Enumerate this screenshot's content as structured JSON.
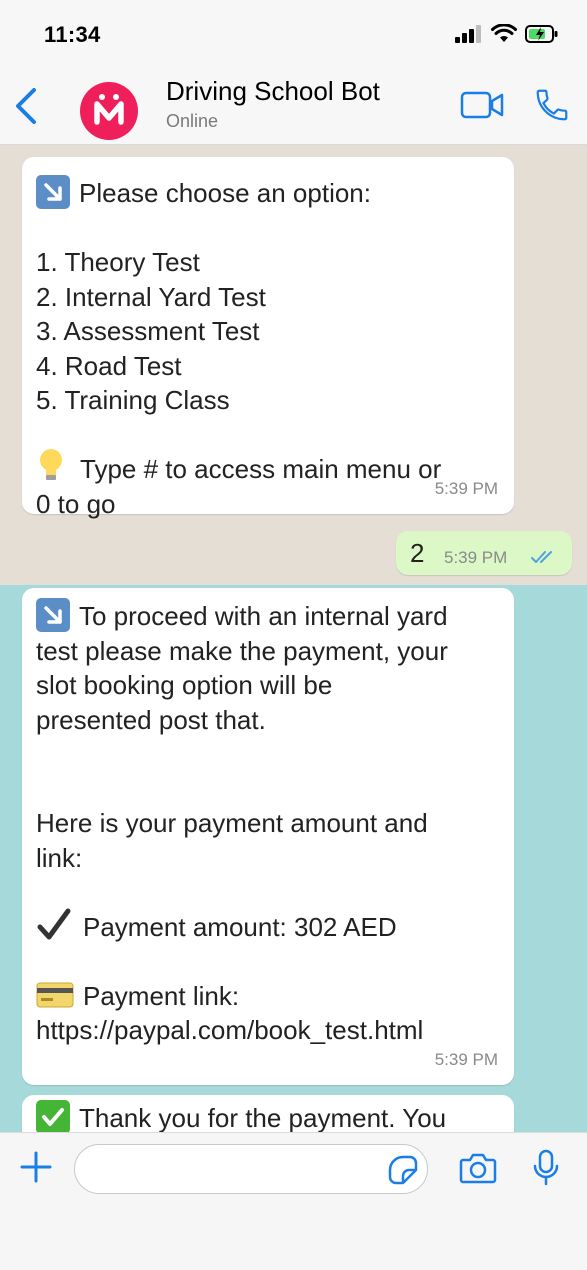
{
  "status_bar": {
    "time": "11:34"
  },
  "header": {
    "contact_name": "Driving School Bot",
    "contact_status": "Online"
  },
  "messages": [
    {
      "direction": "incoming",
      "lines": [
        "Please choose an option:",
        "",
        "1. Theory Test",
        "2. Internal Yard Test",
        "3. Assessment Test",
        "4. Road Test",
        "5. Training Class",
        "",
        "Type # to access main menu or",
        "0 to go"
      ],
      "time": "5:39 PM"
    },
    {
      "direction": "outgoing",
      "text": "2",
      "time": "5:39 PM",
      "status": "read"
    },
    {
      "direction": "incoming",
      "lines": [
        "To proceed with an internal yard",
        "test please make the payment, your",
        "slot booking option will be",
        "presented post that.",
        "",
        "",
        "Here is your payment amount and",
        "link:",
        "",
        "Payment amount: 302 AED",
        "",
        "Payment link:",
        "https://paypal.com/book_test.html"
      ],
      "time": "5:39 PM"
    },
    {
      "direction": "incoming",
      "lines": [
        "Thank you for the payment. You"
      ]
    }
  ],
  "composer": {
    "placeholder": ""
  },
  "colors": {
    "accent": "#1a7ee6",
    "avatar": "#ee1f5a",
    "outgoing_bubble": "#dcf8c6",
    "chat_background": "#e5ded5",
    "highlight": "#a6d9da",
    "read_ticks": "#4fa3e0"
  }
}
